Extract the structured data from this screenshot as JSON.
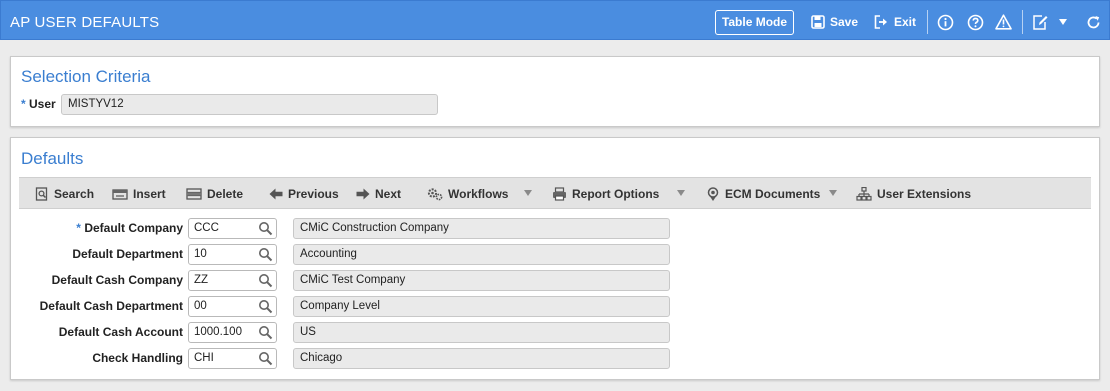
{
  "app": {
    "title": "AP USER DEFAULTS",
    "table_mode_label": "Table Mode",
    "save_label": "Save",
    "exit_label": "Exit"
  },
  "selection": {
    "title": "Selection Criteria",
    "user_label": "User",
    "user_value": "MISTYV12"
  },
  "defaults": {
    "title": "Defaults",
    "toolbar": {
      "search": "Search",
      "insert": "Insert",
      "delete": "Delete",
      "previous": "Previous",
      "next": "Next",
      "workflows": "Workflows",
      "report_options": "Report Options",
      "ecm_documents": "ECM Documents",
      "user_extensions": "User Extensions"
    },
    "fields": [
      {
        "label": "Default Company",
        "required": true,
        "value": "CCC",
        "desc": "CMiC Construction Company"
      },
      {
        "label": "Default Department",
        "required": false,
        "value": "10",
        "desc": "Accounting"
      },
      {
        "label": "Default Cash Company",
        "required": false,
        "value": "ZZ",
        "desc": "CMiC Test Company"
      },
      {
        "label": "Default Cash Department",
        "required": false,
        "value": "00",
        "desc": "Company Level"
      },
      {
        "label": "Default Cash Account",
        "required": false,
        "value": "1000.100",
        "desc": "US"
      },
      {
        "label": "Check Handling",
        "required": false,
        "value": "CHI",
        "desc": "Chicago"
      }
    ]
  },
  "colors": {
    "titlebar": "#4a8de0",
    "accent": "#3a7ed0"
  }
}
